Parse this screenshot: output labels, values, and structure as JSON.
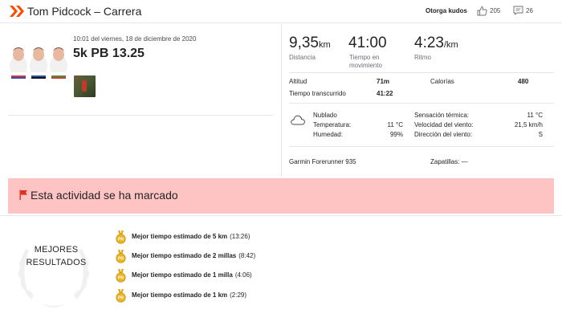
{
  "header": {
    "title": "Tom Pidcock – Carrera",
    "kudos_label": "Otorga kudos",
    "kudos_count": "205",
    "comment_count": "26",
    "brand_color": "#fc4c02"
  },
  "activity": {
    "date": "10:01 del viernes, 18 de diciembre de 2020",
    "name": "5k PB 13.25"
  },
  "stats": {
    "distance": {
      "value": "9,35",
      "unit": "km",
      "label": "Distancia"
    },
    "moving_time": {
      "value": "41:00",
      "label_1": "Tiempo en",
      "label_2": "movimiento"
    },
    "pace": {
      "value": "4:23",
      "unit": "/km",
      "label": "Ritmo"
    }
  },
  "details": {
    "elevation": {
      "label": "Altitud",
      "value": "71m"
    },
    "calories": {
      "label": "Calorías",
      "value": "480"
    },
    "elapsed": {
      "label": "Tiempo transcurrido",
      "value": "41:22"
    }
  },
  "weather": {
    "icon": "cloud-icon",
    "condition": "Nublado",
    "temperature": {
      "label": "Temperatura:",
      "value": "11 °C"
    },
    "humidity": {
      "label": "Humedad:",
      "value": "99%"
    },
    "feels_like": {
      "label": "Sensación térmica:",
      "value": "11 °C"
    },
    "wind_speed": {
      "label": "Velocidad del viento:",
      "value": "21,5 km/h"
    },
    "wind_direction": {
      "label": "Dirección del viento:",
      "value": "S"
    }
  },
  "gear": {
    "device": "Garmin Forerunner 935",
    "shoes": "Zapatillas: —"
  },
  "flag": {
    "text": "Esta actividad se ha marcado",
    "color": "#fec4c4"
  },
  "best_efforts": {
    "title_line1": "MEJORES",
    "title_line2": "RESULTADOS",
    "medal_label": "PR",
    "items": [
      {
        "name": "Mejor tiempo estimado de 5 km",
        "time": "(13:26)"
      },
      {
        "name": "Mejor tiempo estimado de 2 millas",
        "time": "(8:42)"
      },
      {
        "name": "Mejor tiempo estimado de 1 milla",
        "time": "(4:06)"
      },
      {
        "name": "Mejor tiempo estimado de 1 km",
        "time": "(2:29)"
      }
    ]
  }
}
